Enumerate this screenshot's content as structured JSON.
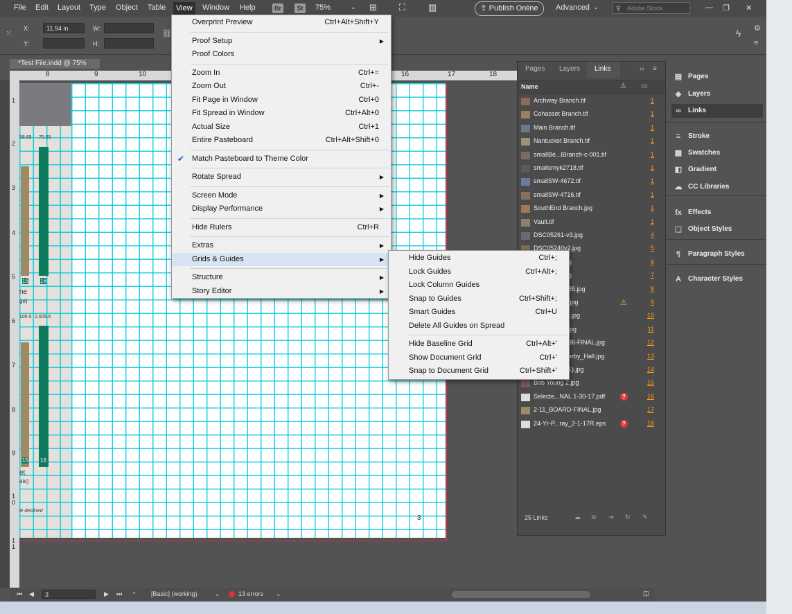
{
  "menubar": {
    "items": [
      "File",
      "Edit",
      "Layout",
      "Type",
      "Object",
      "Table",
      "View",
      "Window",
      "Help"
    ],
    "active": "View",
    "bridge": "Br",
    "stock_chip": "St",
    "zoom": "75%",
    "publish": "Publish Online",
    "workspace": "Advanced",
    "search_placeholder": "Adobe Stock"
  },
  "control": {
    "x_label": "X:",
    "x_value": "11.94 in",
    "y_label": "Y:",
    "w_label": "W:",
    "h_label": "H:"
  },
  "document": {
    "tab": "*Test File.indd @ 75%",
    "page_number": "3"
  },
  "rulers": {
    "h": [
      "8",
      "9",
      "10",
      "16",
      "17",
      "18"
    ],
    "v": [
      "1",
      "2",
      "3",
      "4",
      "5",
      "6",
      "7",
      "8",
      "9",
      "1\n0",
      "1\n1"
    ]
  },
  "spread_labels": {
    "a": "58.85",
    "b": "75.55",
    "c": "15",
    "d": "16",
    "e": "105.5",
    "f": "2,605.6",
    "g": "15",
    "h": "16",
    "i": "ne",
    "j": "ge)",
    "k": "et",
    "l": "ats)",
    "m": "le declined"
  },
  "view_menu": [
    {
      "label": "Overprint Preview",
      "shortcut": "Ctrl+Alt+Shift+Y"
    },
    {
      "sep": true
    },
    {
      "label": "Proof Setup",
      "submenu": true
    },
    {
      "label": "Proof Colors"
    },
    {
      "sep": true
    },
    {
      "label": "Zoom In",
      "shortcut": "Ctrl+="
    },
    {
      "label": "Zoom Out",
      "shortcut": "Ctrl+-"
    },
    {
      "label": "Fit Page in Window",
      "shortcut": "Ctrl+0"
    },
    {
      "label": "Fit Spread in Window",
      "shortcut": "Ctrl+Alt+0"
    },
    {
      "label": "Actual Size",
      "shortcut": "Ctrl+1"
    },
    {
      "label": "Entire Pasteboard",
      "shortcut": "Ctrl+Alt+Shift+0"
    },
    {
      "sep": true
    },
    {
      "label": "Match Pasteboard to Theme Color",
      "checked": true
    },
    {
      "sep": true
    },
    {
      "label": "Rotate Spread",
      "submenu": true
    },
    {
      "sep": true
    },
    {
      "label": "Screen Mode",
      "submenu": true
    },
    {
      "label": "Display Performance",
      "submenu": true
    },
    {
      "sep": true
    },
    {
      "label": "Hide Rulers",
      "shortcut": "Ctrl+R"
    },
    {
      "sep": true
    },
    {
      "label": "Extras",
      "submenu": true
    },
    {
      "label": "Grids & Guides",
      "submenu": true,
      "highlight": true
    },
    {
      "sep": true
    },
    {
      "label": "Structure",
      "submenu": true
    },
    {
      "label": "Story Editor",
      "submenu": true
    }
  ],
  "grids_menu": [
    {
      "label": "Hide Guides",
      "shortcut": "Ctrl+;"
    },
    {
      "label": "Lock Guides",
      "shortcut": "Ctrl+Alt+;"
    },
    {
      "label": "Lock Column Guides"
    },
    {
      "label": "Snap to Guides",
      "shortcut": "Ctrl+Shift+;"
    },
    {
      "label": "Smart Guides",
      "shortcut": "Ctrl+U"
    },
    {
      "label": "Delete All Guides on Spread"
    },
    {
      "sep": true
    },
    {
      "label": "Hide Baseline Grid",
      "shortcut": "Ctrl+Alt+'"
    },
    {
      "label": "Show Document Grid",
      "shortcut": "Ctrl+'"
    },
    {
      "label": "Snap to Document Grid",
      "shortcut": "Ctrl+Shift+'"
    }
  ],
  "links_panel": {
    "tabs": [
      "Pages",
      "Layers",
      "Links"
    ],
    "active_tab": "Links",
    "column_name": "Name",
    "rows": [
      {
        "name": "Archway Branch.tif",
        "page": "1"
      },
      {
        "name": "Cohasset Branch.tif",
        "page": "1"
      },
      {
        "name": "Main Branch.tif",
        "page": "1"
      },
      {
        "name": "Nantucket Branch.tif",
        "page": "1"
      },
      {
        "name": "smallBe...lBranch-c-001.tif",
        "page": "1"
      },
      {
        "name": "smallcmyk2718.tif",
        "page": "1"
      },
      {
        "name": "smallSW-4672.tif",
        "page": "1"
      },
      {
        "name": "smallSW-4716.tif",
        "page": "1"
      },
      {
        "name": "SouthEnd Branch.jpg",
        "page": "1"
      },
      {
        "name": "Vault.tif",
        "page": "1"
      },
      {
        "name": "DSC05261-v3.jpg",
        "page": "4"
      },
      {
        "name": "DSC05240v2.jpg",
        "page": "5"
      },
      {
        "name": "",
        "page": "6",
        "tail": "g"
      },
      {
        "name": "",
        "page": "7",
        "tail": "g"
      },
      {
        "name": "",
        "page": "8",
        "tail": "85.jpg"
      },
      {
        "name": "",
        "page": "9",
        "tail": ".jpg",
        "status": "warning"
      },
      {
        "name": "",
        "page": "10",
        "tail": "r.jpg"
      },
      {
        "name": "",
        "page": "11",
        "tail": "jpg"
      },
      {
        "name": "",
        "page": "12",
        "tail": "36-FINAL.jpg"
      },
      {
        "name": "",
        "page": "13",
        "tail": "erby_Hall.jpg"
      },
      {
        "name": "",
        "page": "14",
        "tail": "1).jpg"
      },
      {
        "name": "Bob Young 2.jpg",
        "page": "15"
      },
      {
        "name": "Selecte...NAL 1-30-17.pdf",
        "page": "16",
        "status": "missing"
      },
      {
        "name": "2-11_BOARD-FINAL.jpg",
        "page": "17"
      },
      {
        "name": "24-Yr-P...ray_2-1-17R.eps",
        "page": "18",
        "status": "missing"
      }
    ],
    "footer": "25 Links"
  },
  "dock": [
    {
      "label": "Pages",
      "icon": "pages-icon",
      "glyph": "▤"
    },
    {
      "label": "Layers",
      "icon": "layers-icon",
      "glyph": "◈"
    },
    {
      "label": "Links",
      "icon": "links-icon",
      "glyph": "∞",
      "selected": true
    },
    {
      "label": "Stroke",
      "icon": "stroke-icon",
      "glyph": "≡"
    },
    {
      "label": "Swatches",
      "icon": "swatches-icon",
      "glyph": "▦"
    },
    {
      "label": "Gradient",
      "icon": "gradient-icon",
      "glyph": "◧"
    },
    {
      "label": "CC Libraries",
      "icon": "cc-libraries-icon",
      "glyph": "☁"
    },
    {
      "label": "Effects",
      "icon": "effects-icon",
      "glyph": "fx"
    },
    {
      "label": "Object Styles",
      "icon": "object-styles-icon",
      "glyph": "⬚"
    },
    {
      "label": "Paragraph Styles",
      "icon": "paragraph-styles-icon",
      "glyph": "¶"
    },
    {
      "label": "Character Styles",
      "icon": "character-styles-icon",
      "glyph": "A"
    }
  ],
  "status": {
    "page": "3",
    "style": "[Basic] (working)",
    "errors": "13 errors"
  }
}
